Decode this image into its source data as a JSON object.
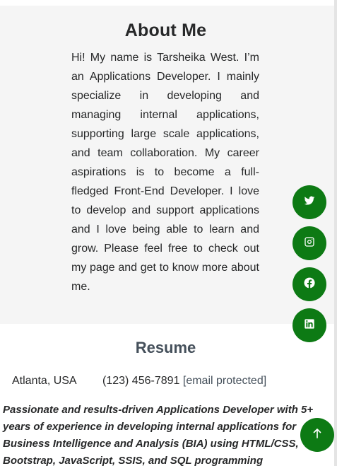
{
  "about": {
    "title": "About Me",
    "text": "Hi! My name is Tarsheika West. I’m an Applications Developer. I mainly specialize in developing and managing internal applications, supporting large scale applications, and team collaboration. My career aspirations is to become a full-fledged Front-End Developer. I love to develop and support applications and I love being able to learn and grow. Please feel free to check out my page and get to know more about me."
  },
  "resume": {
    "title": "Resume",
    "location": "Atlanta, USA",
    "phone": "(123) 456-7891",
    "email": "[email protected]",
    "summary": "Passionate and results-driven Applications Developer with 5+ years of experience in developing internal applications for Business Intelligence and Analysis (BIA) using HTML/CSS, Bootstrap, JavaScript, SSIS, and SQL programming languages."
  },
  "social": [
    {
      "icon": "twitter-icon"
    },
    {
      "icon": "instagram-icon"
    },
    {
      "icon": "facebook-icon"
    },
    {
      "icon": "linkedin-icon"
    }
  ],
  "colors": {
    "accent": "#0d7a14",
    "section_bg": "#f5f5f5",
    "heading": "#272829",
    "resume_heading": "#45505b"
  },
  "back_to_top_icon": "arrow-up-icon"
}
